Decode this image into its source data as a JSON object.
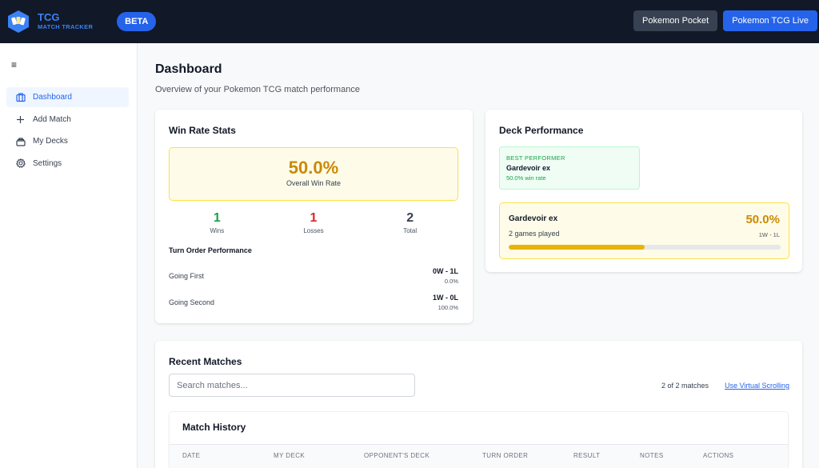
{
  "topbar": {
    "brand_title": "TCG",
    "brand_subtitle": "MATCH TRACKER",
    "beta": "BETA",
    "buttons": {
      "pocket": "Pokemon Pocket",
      "live": "Pokemon TCG Live"
    }
  },
  "sidebar": {
    "menu_glyph": "≡",
    "items": [
      {
        "label": "Dashboard",
        "icon": "dashboard-icon",
        "active": true
      },
      {
        "label": "Add Match",
        "icon": "plus-icon"
      },
      {
        "label": "My Decks",
        "icon": "decks-icon"
      },
      {
        "label": "Settings",
        "icon": "gear-icon"
      }
    ]
  },
  "page": {
    "title": "Dashboard",
    "subtitle": "Overview of your Pokemon TCG match performance"
  },
  "win_rate": {
    "title": "Win Rate Stats",
    "value": "50.0%",
    "label": "Overall Win Rate",
    "stats": [
      {
        "value": "1",
        "label": "Wins",
        "color": "#16a34a"
      },
      {
        "value": "1",
        "label": "Losses",
        "color": "#dc2626"
      },
      {
        "value": "2",
        "label": "Total",
        "color": "#374151"
      }
    ],
    "turn_order": {
      "title": "Turn Order Performance",
      "rows": [
        {
          "label": "Going First",
          "record": "0W - 1L",
          "pct": "0.0%"
        },
        {
          "label": "Going Second",
          "record": "1W - 0L",
          "pct": "100.0%"
        }
      ]
    }
  },
  "deck_perf": {
    "title": "Deck Performance",
    "best": {
      "key": "BEST PERFORMER",
      "name": "Gardevoir ex",
      "rate": "50.0% win rate"
    },
    "decks": [
      {
        "name": "Gardevoir ex",
        "games": "2 games played",
        "pct": "50.0%",
        "record": "1W - 1L",
        "progress": 0.5
      }
    ]
  },
  "recent": {
    "title": "Recent Matches",
    "search_placeholder": "Search matches...",
    "count": "2 of 2 matches",
    "virtual_link": "Use Virtual Scrolling",
    "history_title": "Match History",
    "columns": [
      "DATE",
      "MY DECK",
      "OPPONENT'S DECK",
      "TURN ORDER",
      "RESULT",
      "NOTES",
      "ACTIONS"
    ]
  },
  "colors": {
    "accent": "#2563eb",
    "topbar": "#111827",
    "win": "#16a34a",
    "loss": "#dc2626",
    "gold": "#ca8a04"
  }
}
